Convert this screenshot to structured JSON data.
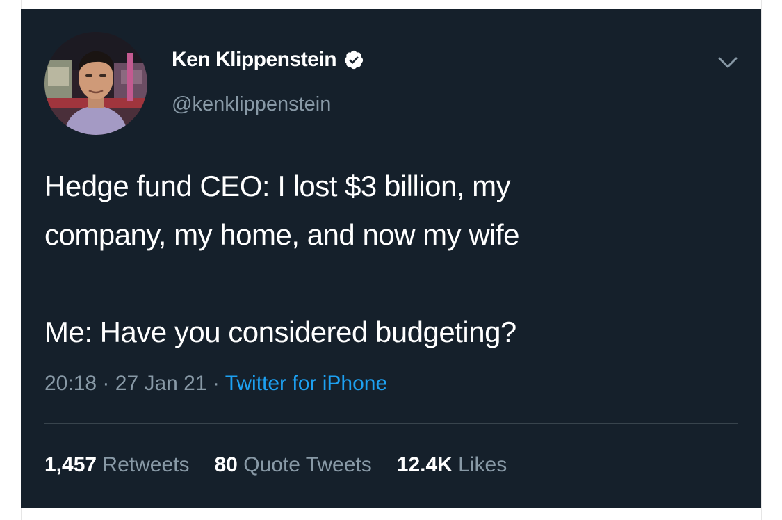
{
  "tweet": {
    "author": {
      "display_name": "Ken Klippenstein",
      "handle": "@kenklippenstein",
      "verified": true,
      "avatar_icon": "profile-photo"
    },
    "text_lines": [
      "Hedge fund CEO: I lost $3 billion, my",
      "company, my home, and now my wife",
      "",
      "Me: Have you considered budgeting?"
    ],
    "time": "20:18",
    "date": "27 Jan 21",
    "source": "Twitter for iPhone",
    "separator": "·",
    "stats": {
      "retweets": {
        "count": "1,457",
        "label": "Retweets"
      },
      "quotes": {
        "count": "80",
        "label": "Quote Tweets"
      },
      "likes": {
        "count": "12.4K",
        "label": "Likes"
      }
    },
    "menu_icon": "chevron-down-icon"
  },
  "colors": {
    "card_background": "#15202b",
    "text_primary": "#ffffff",
    "text_secondary": "#8899a6",
    "link": "#1da1f2",
    "divider": "#38444d"
  }
}
